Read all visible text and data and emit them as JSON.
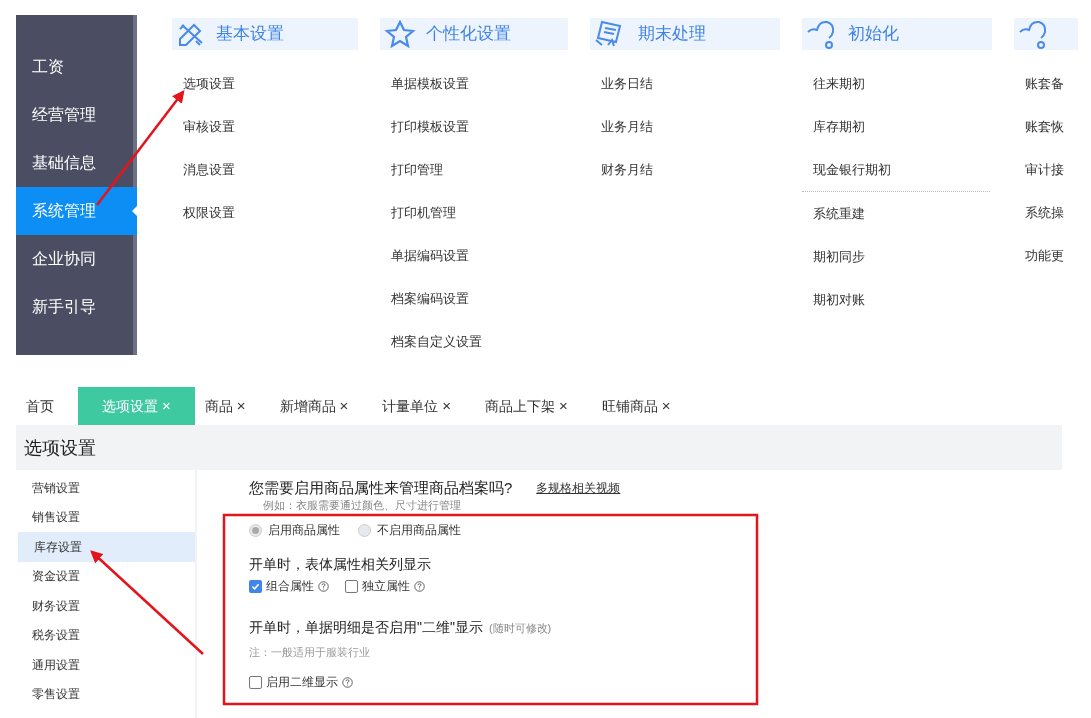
{
  "sidebar": {
    "items": [
      {
        "label": "工资",
        "selected": false
      },
      {
        "label": "经营管理",
        "selected": false
      },
      {
        "label": "基础信息",
        "selected": false
      },
      {
        "label": "系统管理",
        "selected": true
      },
      {
        "label": "企业协同",
        "selected": false
      },
      {
        "label": "新手引导",
        "selected": false
      }
    ]
  },
  "menu": {
    "columns": [
      {
        "title": "基本设置",
        "groups": [
          {
            "items": [
              "选项设置",
              "审核设置",
              "消息设置",
              "权限设置"
            ]
          }
        ]
      },
      {
        "title": "个性化设置",
        "groups": [
          {
            "items": [
              "单据模板设置",
              "打印模板设置",
              "打印管理",
              "打印机管理",
              "单据编码设置",
              "档案编码设置",
              "档案自定义设置"
            ]
          }
        ]
      },
      {
        "title": "期末处理",
        "groups": [
          {
            "items": [
              "业务日结",
              "业务月结",
              "财务月结"
            ]
          }
        ]
      },
      {
        "title": "初始化",
        "groups": [
          {
            "items": [
              "往来期初",
              "库存期初",
              "现金银行期初"
            ]
          },
          {
            "items": [
              "系统重建",
              "期初同步",
              "期初对账"
            ]
          }
        ]
      },
      {
        "groups": [
          {
            "items": [
              "账套备",
              "账套恢",
              "审计接",
              "系统操",
              "功能更"
            ]
          }
        ]
      }
    ]
  },
  "tabs": [
    {
      "label": "首页",
      "selected": false
    },
    {
      "label": "选项设置",
      "close": "×",
      "selected": true
    },
    {
      "label": "商品",
      "close": "×",
      "selected": false
    },
    {
      "label": "新增商品",
      "close": "×",
      "selected": false
    },
    {
      "label": "计量单位",
      "close": "×",
      "selected": false
    },
    {
      "label": "商品上下架",
      "close": "×",
      "selected": false
    },
    {
      "label": "旺铺商品",
      "close": "×",
      "selected": false
    }
  ],
  "page_title": "选项设置",
  "settings_nav": [
    {
      "label": "营销设置",
      "selected": false
    },
    {
      "label": "销售设置",
      "selected": false
    },
    {
      "label": "库存设置",
      "selected": true
    },
    {
      "label": "资金设置",
      "selected": false
    },
    {
      "label": "财务设置",
      "selected": false
    },
    {
      "label": "税务设置",
      "selected": false
    },
    {
      "label": "通用设置",
      "selected": false
    },
    {
      "label": "零售设置",
      "selected": false
    }
  ],
  "content": {
    "question": "您需要启用商品属性来管理商品档案吗?",
    "link": "多规格相关视频",
    "example": "例如：衣服需要通过颜色、尺寸进行管理",
    "radios": [
      {
        "label": "启用商品属性",
        "selected": true
      },
      {
        "label": "不启用商品属性",
        "selected": false
      }
    ],
    "heading_1": "开单时，表体属性相关列显示",
    "checkboxes_1": [
      {
        "label": "组合属性",
        "checked": true
      },
      {
        "label": "独立属性",
        "checked": false
      }
    ],
    "heading_2": "开单时，单据明细是否启用\"二维\"显示",
    "heading_2_hint": "(随时可修改)",
    "note": "注：一般适用于服装行业",
    "checkboxes_2": [
      {
        "label": "启用二维显示",
        "checked": false
      }
    ]
  }
}
